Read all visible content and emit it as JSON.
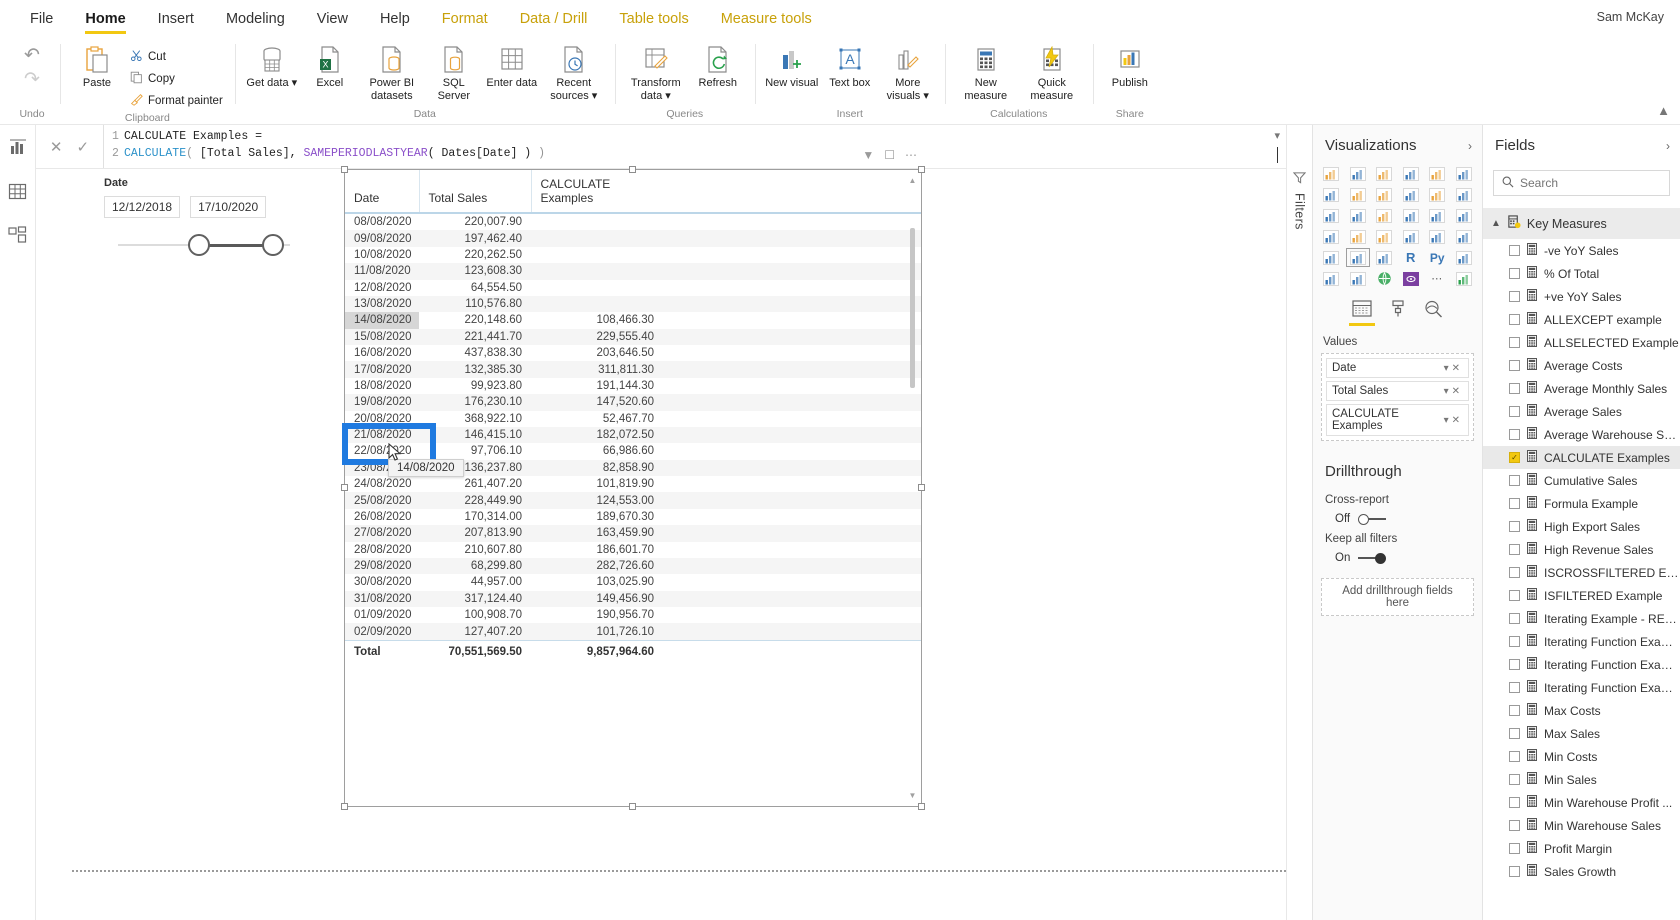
{
  "titlebar": {
    "user": "Sam McKay"
  },
  "menu": {
    "items": [
      {
        "label": "File",
        "state": "normal"
      },
      {
        "label": "Home",
        "state": "active"
      },
      {
        "label": "Insert",
        "state": "normal"
      },
      {
        "label": "Modeling",
        "state": "normal"
      },
      {
        "label": "View",
        "state": "normal"
      },
      {
        "label": "Help",
        "state": "normal"
      },
      {
        "label": "Format",
        "state": "context"
      },
      {
        "label": "Data / Drill",
        "state": "context"
      },
      {
        "label": "Table tools",
        "state": "context"
      },
      {
        "label": "Measure tools",
        "state": "context"
      }
    ]
  },
  "ribbon": {
    "groups": [
      {
        "name": "Undo",
        "label": "Undo"
      },
      {
        "name": "Clipboard",
        "label": "Clipboard",
        "buttons": [
          {
            "label": "Paste",
            "icon": "clipboard-icon"
          }
        ],
        "small": [
          {
            "label": "Cut",
            "icon": "scissors-icon"
          },
          {
            "label": "Copy",
            "icon": "copy-icon"
          },
          {
            "label": "Format painter",
            "icon": "paintbrush-icon"
          }
        ]
      },
      {
        "name": "Data",
        "label": "Data",
        "buttons": [
          {
            "label": "Get data",
            "icon": "database-icon",
            "caret": true
          },
          {
            "label": "Excel",
            "icon": "excel-icon"
          },
          {
            "label": "Power BI datasets",
            "icon": "powerbi-dataset-icon"
          },
          {
            "label": "SQL Server",
            "icon": "sql-server-icon"
          },
          {
            "label": "Enter data",
            "icon": "grid-icon"
          },
          {
            "label": "Recent sources",
            "icon": "clock-icon",
            "caret": true
          }
        ]
      },
      {
        "name": "Queries",
        "label": "Queries",
        "buttons": [
          {
            "label": "Transform data",
            "icon": "transform-icon",
            "caret": true
          },
          {
            "label": "Refresh",
            "icon": "refresh-icon"
          }
        ]
      },
      {
        "name": "Insert",
        "label": "Insert",
        "buttons": [
          {
            "label": "New visual",
            "icon": "new-visual-icon"
          },
          {
            "label": "Text box",
            "icon": "textbox-icon"
          },
          {
            "label": "More visuals",
            "icon": "more-visuals-icon",
            "caret": true
          }
        ]
      },
      {
        "name": "Calculations",
        "label": "Calculations",
        "buttons": [
          {
            "label": "New measure",
            "icon": "new-measure-icon"
          },
          {
            "label": "Quick measure",
            "icon": "quick-measure-icon"
          }
        ]
      },
      {
        "name": "Share",
        "label": "Share",
        "buttons": [
          {
            "label": "Publish",
            "icon": "publish-icon"
          }
        ]
      }
    ],
    "collapse_icon": "chevron-up-icon"
  },
  "leftrail": {
    "items": [
      {
        "name": "report-view",
        "icon": "report-icon",
        "selected": true
      },
      {
        "name": "data-view",
        "icon": "table-icon",
        "selected": false
      },
      {
        "name": "model-view",
        "icon": "model-icon",
        "selected": false
      }
    ]
  },
  "formula": {
    "cancel_icon": "close-icon",
    "accept_icon": "check-icon",
    "expand_icon": "chevron-down-icon",
    "lines": [
      {
        "no": "1",
        "parts": [
          {
            "t": "CALCULATE Examples =",
            "c": "plain"
          }
        ]
      },
      {
        "no": "2",
        "parts": [
          {
            "t": "CALCULATE",
            "c": "kw"
          },
          {
            "t": "(",
            "c": "paren"
          },
          {
            "t": " [Total Sales], ",
            "c": "plain"
          },
          {
            "t": "SAMEPERIODLASTYEAR",
            "c": "fn"
          },
          {
            "t": "( Dates[Date] ) ",
            "c": "plain"
          },
          {
            "t": ")",
            "c": "paren"
          }
        ]
      }
    ]
  },
  "slicer": {
    "title": "Date",
    "start": "12/12/2018",
    "end": "17/10/2020"
  },
  "visual": {
    "columns": [
      "Date",
      "Total Sales",
      "CALCULATE Examples"
    ],
    "rows": [
      {
        "date": "08/08/2020",
        "total": "220,007.90",
        "calc": ""
      },
      {
        "date": "09/08/2020",
        "total": "197,462.40",
        "calc": ""
      },
      {
        "date": "10/08/2020",
        "total": "220,262.50",
        "calc": ""
      },
      {
        "date": "11/08/2020",
        "total": "123,608.30",
        "calc": ""
      },
      {
        "date": "12/08/2020",
        "total": "64,554.50",
        "calc": ""
      },
      {
        "date": "13/08/2020",
        "total": "110,576.80",
        "calc": ""
      },
      {
        "date": "14/08/2020",
        "total": "220,148.60",
        "calc": "108,466.30"
      },
      {
        "date": "15/08/2020",
        "total": "221,441.70",
        "calc": "229,555.40"
      },
      {
        "date": "16/08/2020",
        "total": "437,838.30",
        "calc": "203,646.50"
      },
      {
        "date": "17/08/2020",
        "total": "132,385.30",
        "calc": "311,811.30"
      },
      {
        "date": "18/08/2020",
        "total": "99,923.80",
        "calc": "191,144.30"
      },
      {
        "date": "19/08/2020",
        "total": "176,230.10",
        "calc": "147,520.60"
      },
      {
        "date": "20/08/2020",
        "total": "368,922.10",
        "calc": "52,467.70"
      },
      {
        "date": "21/08/2020",
        "total": "146,415.10",
        "calc": "182,072.50"
      },
      {
        "date": "22/08/2020",
        "total": "97,706.10",
        "calc": "66,986.60"
      },
      {
        "date": "23/08/2020",
        "total": "136,237.80",
        "calc": "82,858.90"
      },
      {
        "date": "24/08/2020",
        "total": "261,407.20",
        "calc": "101,819.90"
      },
      {
        "date": "25/08/2020",
        "total": "228,449.90",
        "calc": "124,553.00"
      },
      {
        "date": "26/08/2020",
        "total": "170,314.00",
        "calc": "189,670.30"
      },
      {
        "date": "27/08/2020",
        "total": "207,813.90",
        "calc": "163,459.90"
      },
      {
        "date": "28/08/2020",
        "total": "210,607.80",
        "calc": "186,601.70"
      },
      {
        "date": "29/08/2020",
        "total": "68,299.80",
        "calc": "282,726.60"
      },
      {
        "date": "30/08/2020",
        "total": "44,957.00",
        "calc": "103,025.90"
      },
      {
        "date": "31/08/2020",
        "total": "317,124.40",
        "calc": "149,456.90"
      },
      {
        "date": "01/09/2020",
        "total": "100,908.70",
        "calc": "190,956.70"
      },
      {
        "date": "02/09/2020",
        "total": "127,407.20",
        "calc": "101,726.10"
      }
    ],
    "total_row": {
      "label": "Total",
      "total": "70,551,569.50",
      "calc": "9,857,964.60"
    },
    "tooltip": "14/08/2020",
    "annotation_color": "#1f7ae0"
  },
  "filters_pane": {
    "label": "Filters",
    "icon": "filter-icon"
  },
  "visualizations": {
    "title": "Visualizations",
    "expand_icon": "chevron-right-icon",
    "format_tabs": [
      {
        "name": "fields-tab",
        "icon": "fields-icon",
        "selected": true
      },
      {
        "name": "format-tab",
        "icon": "paint-roller-icon",
        "selected": false
      },
      {
        "name": "analytics-tab",
        "icon": "magnifier-icon",
        "selected": false
      }
    ],
    "values_label": "Values",
    "values": [
      {
        "label": "Date"
      },
      {
        "label": "Total Sales"
      },
      {
        "label": "CALCULATE Examples"
      }
    ],
    "drillthrough": {
      "title": "Drillthrough",
      "cross_report_label": "Cross-report",
      "cross_report_state": "Off",
      "keep_filters_label": "Keep all filters",
      "keep_filters_state": "On",
      "dropzone": "Add drillthrough fields here"
    }
  },
  "fields": {
    "title": "Fields",
    "expand_icon": "chevron-right-icon",
    "search_placeholder": "Search",
    "search_icon": "search-icon",
    "table_group": {
      "label": "Key Measures",
      "icon": "measure-table-icon",
      "chevron": "chevron-up-icon"
    },
    "items": [
      {
        "label": "-ve YoY Sales",
        "checked": false
      },
      {
        "label": "% Of Total",
        "checked": false
      },
      {
        "label": "+ve YoY Sales",
        "checked": false
      },
      {
        "label": "ALLEXCEPT example",
        "checked": false
      },
      {
        "label": "ALLSELECTED Example",
        "checked": false
      },
      {
        "label": "Average Costs",
        "checked": false
      },
      {
        "label": "Average Monthly Sales",
        "checked": false
      },
      {
        "label": "Average Sales",
        "checked": false
      },
      {
        "label": "Average Warehouse Sales",
        "checked": false
      },
      {
        "label": "CALCULATE Examples",
        "checked": true
      },
      {
        "label": "Cumulative Sales",
        "checked": false
      },
      {
        "label": "Formula Example",
        "checked": false
      },
      {
        "label": "High Export Sales",
        "checked": false
      },
      {
        "label": "High Revenue Sales",
        "checked": false
      },
      {
        "label": "ISCROSSFILTERED Exam...",
        "checked": false
      },
      {
        "label": "ISFILTERED Example",
        "checked": false
      },
      {
        "label": "Iterating Example - REL...",
        "checked": false
      },
      {
        "label": "Iterating Function Exam...",
        "checked": false
      },
      {
        "label": "Iterating Function Exam...",
        "checked": false
      },
      {
        "label": "Iterating Function Exam...",
        "checked": false
      },
      {
        "label": "Max Costs",
        "checked": false
      },
      {
        "label": "Max Sales",
        "checked": false
      },
      {
        "label": "Min Costs",
        "checked": false
      },
      {
        "label": "Min Sales",
        "checked": false
      },
      {
        "label": "Min Warehouse Profit ...",
        "checked": false
      },
      {
        "label": "Min Warehouse Sales",
        "checked": false
      },
      {
        "label": "Profit Margin",
        "checked": false
      },
      {
        "label": "Sales Growth",
        "checked": false
      }
    ]
  }
}
